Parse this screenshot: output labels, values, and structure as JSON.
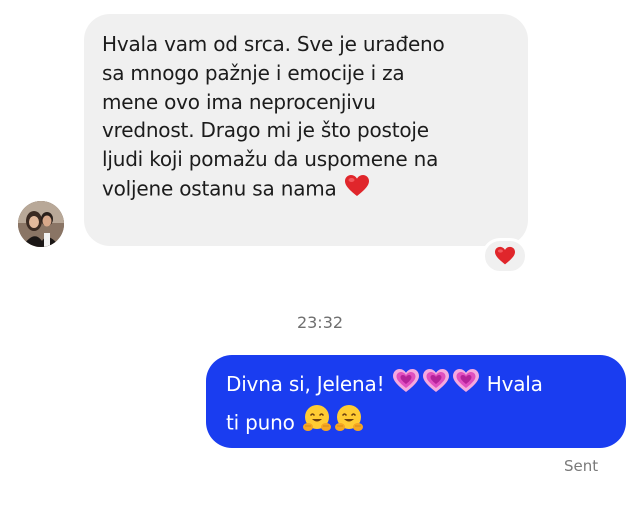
{
  "incoming": {
    "lines": [
      "Hvala vam od srca. Sve je urađeno",
      "sa mnogo pažnje i emocije i za",
      "mene ovo ima neprocenjivu",
      "vrednost. Drago mi je što postoje",
      "ljudi koji pomažu da uspomene na",
      "voljene ostanu sa nama"
    ],
    "reaction_icon": "red-heart-icon"
  },
  "timestamp": "23:32",
  "outgoing": {
    "line1_a": "Divna si, Jelena!",
    "line1_b": "Hvala",
    "line2": "ti puno",
    "emojis": [
      "growing-heart-icon",
      "growing-heart-icon",
      "growing-heart-icon",
      "hugging-face-icon",
      "hugging-face-icon"
    ]
  },
  "status": "Sent",
  "colors": {
    "outgoing_bubble": "#1a3df0",
    "incoming_bubble": "#f0f0f0",
    "heart": "#e0262b"
  }
}
